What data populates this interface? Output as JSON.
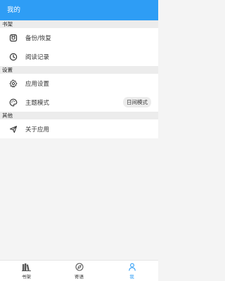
{
  "appbar": {
    "title": "我的"
  },
  "sections": [
    {
      "header": "书架",
      "items": [
        {
          "label": "备份/恢复"
        },
        {
          "label": "阅读记录"
        }
      ]
    },
    {
      "header": "设置",
      "items": [
        {
          "label": "应用设置"
        },
        {
          "label": "主题模式",
          "badge": "日间模式"
        }
      ]
    },
    {
      "header": "其他",
      "items": [
        {
          "label": "关于应用"
        }
      ]
    }
  ],
  "bottom_nav": [
    {
      "label": "书架",
      "icon": "bookshelf-icon",
      "active": false
    },
    {
      "label": "寄语",
      "icon": "compass-icon",
      "active": false
    },
    {
      "label": "我",
      "icon": "person-icon",
      "active": true
    }
  ],
  "colors": {
    "accent": "#2e9df5",
    "section_bg": "#ececec"
  }
}
